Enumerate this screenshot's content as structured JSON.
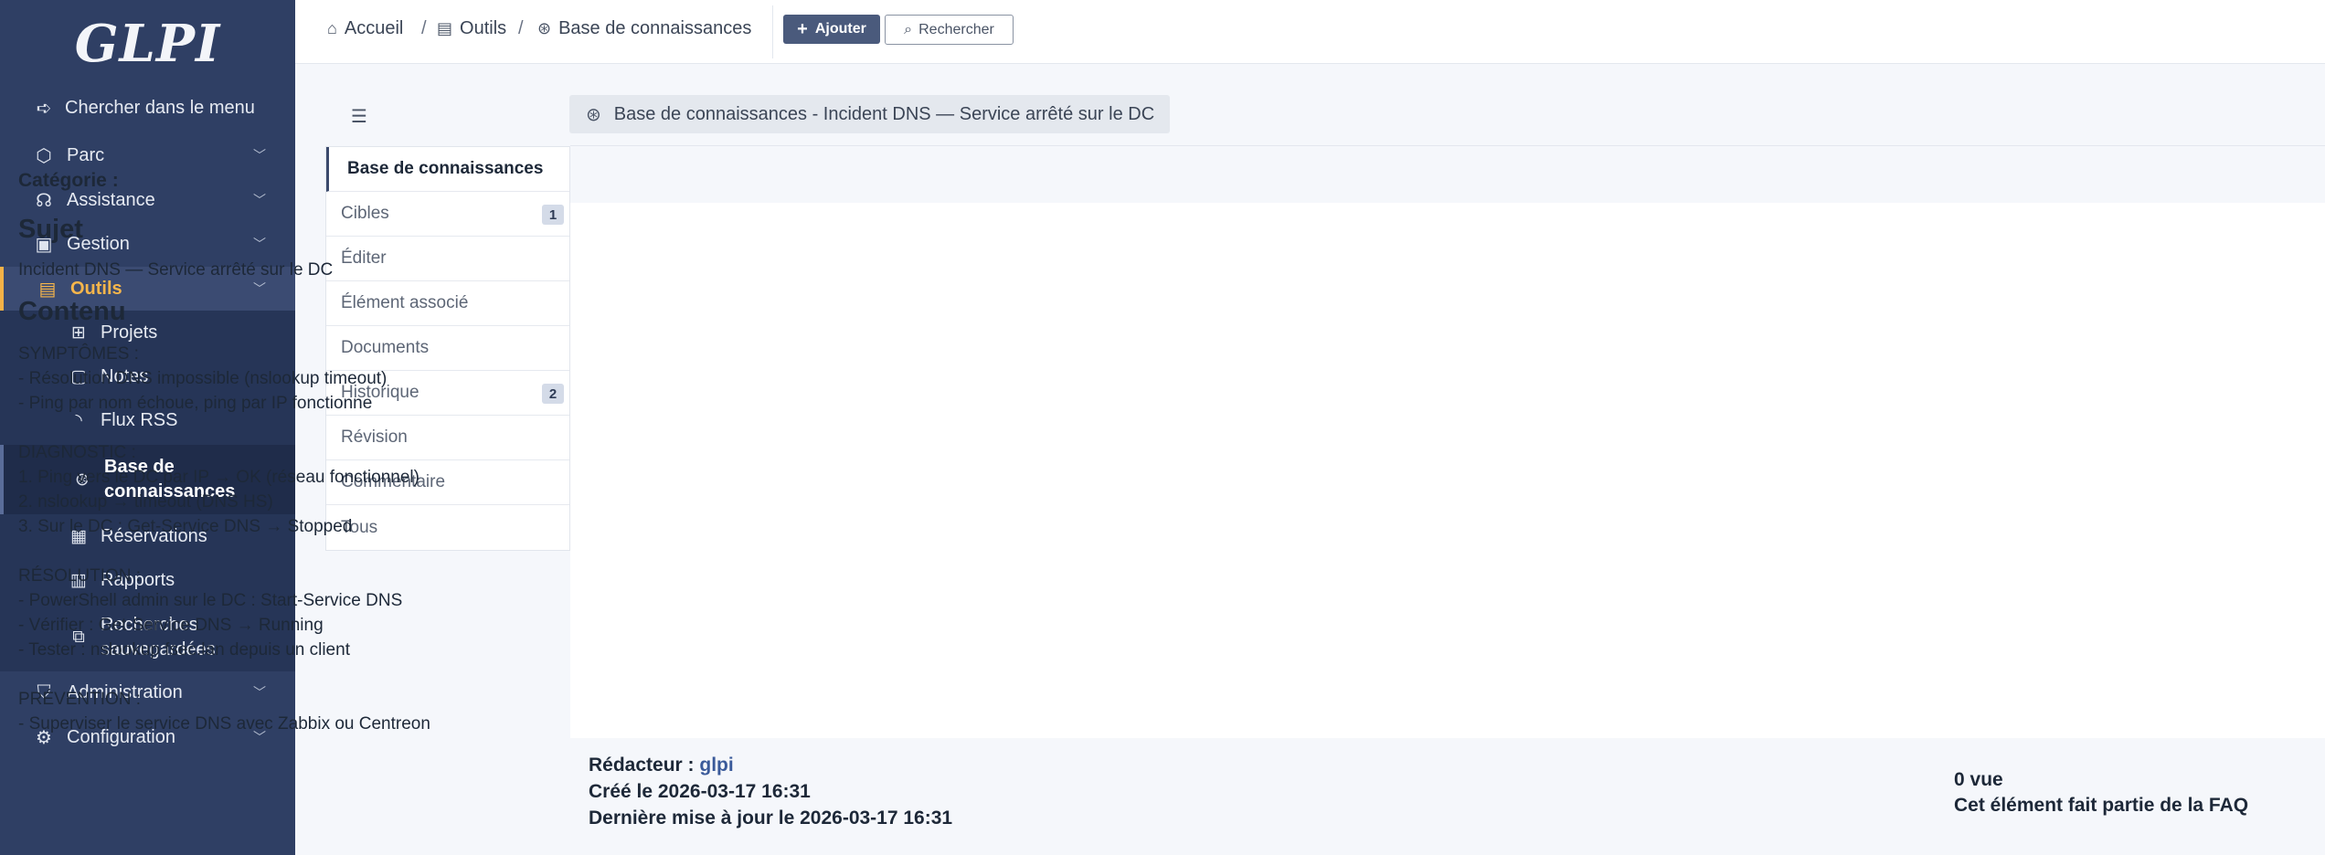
{
  "sidebar": {
    "logo": "GLPI",
    "search_label": "Chercher dans le menu",
    "items": [
      {
        "label": "Parc",
        "icon": "cube-icon"
      },
      {
        "label": "Assistance",
        "icon": "headset-icon"
      },
      {
        "label": "Gestion",
        "icon": "wallet-icon"
      },
      {
        "label": "Outils",
        "icon": "briefcase-icon"
      },
      {
        "label": "Administration",
        "icon": "shield-icon"
      },
      {
        "label": "Configuration",
        "icon": "gear-icon"
      }
    ],
    "sub_items": [
      {
        "label": "Projets",
        "icon": "project-icon"
      },
      {
        "label": "Notes",
        "icon": "note-icon"
      },
      {
        "label": "Flux RSS",
        "icon": "rss-icon"
      },
      {
        "label": "Base de connaissances",
        "icon": "lifebuoy-icon"
      },
      {
        "label": "Réservations",
        "icon": "calendar-icon"
      },
      {
        "label": "Rapports",
        "icon": "report-icon"
      },
      {
        "label": "Recherches sauvegardées",
        "icon": "bookmark-icon"
      }
    ]
  },
  "breadcrumb": {
    "home": "Accueil",
    "tools": "Outils",
    "kb": "Base de connaissances"
  },
  "toolbar": {
    "add_label": "Ajouter",
    "search_label": "Rechercher"
  },
  "tabs": [
    {
      "label": "Base de connaissances"
    },
    {
      "label": "Cibles",
      "badge": "1"
    },
    {
      "label": "Éditer"
    },
    {
      "label": "Élément associé"
    },
    {
      "label": "Documents"
    },
    {
      "label": "Historique",
      "badge": "2"
    },
    {
      "label": "Révision"
    },
    {
      "label": "Commentaire"
    },
    {
      "label": "Tous"
    }
  ],
  "item_title": "Base de connaissances - Incident DNS — Service arrêté sur le DC",
  "article": {
    "category_label": "Catégorie :",
    "subject_heading": "Sujet",
    "subject": "Incident DNS — Service arrêté sur le DC",
    "content_heading": "Contenu",
    "content_lines": [
      "SYMPTÔMES :",
      "- Résolution DNS impossible (nslookup timeout)",
      "- Ping par nom échoue, ping par IP fonctionne",
      "",
      "DIAGNOSTIC :",
      "1. Ping vers le DC par IP → OK (réseau fonctionnel)",
      "2. nslookup → timeout (DNS HS)",
      "3. Sur le DC : Get-Service DNS → Stopped",
      "",
      "RÉSOLUTION :",
      "- PowerShell admin sur le DC : Start-Service DNS",
      "- Vérifier : Get-Service DNS → Running",
      "- Tester : nslookup fsec.lan depuis un client",
      "",
      "PRÉVENTION :",
      "- Superviser le service DNS avec Zabbix ou Centreon"
    ]
  },
  "footer": {
    "author_label": "Rédacteur : ",
    "author": "glpi",
    "created": "Créé le 2026-03-17 16:31",
    "updated": "Dernière mise à jour le 2026-03-17 16:31",
    "views": "0 vue",
    "faq": "Cet élément fait partie de la FAQ"
  }
}
